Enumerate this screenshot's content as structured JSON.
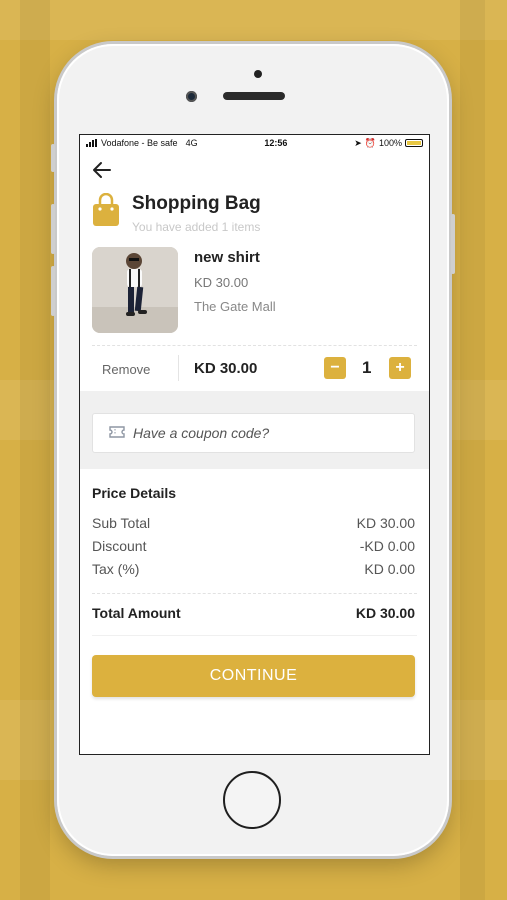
{
  "colors": {
    "accent": "#dcb13e",
    "background": "#d7b046"
  },
  "status_bar": {
    "carrier": "Vodafone - Be safe",
    "network": "4G",
    "time": "12:56",
    "battery": "100%"
  },
  "header": {
    "back_icon": "arrow-left-icon",
    "bag_icon": "shopping-bag-icon",
    "title": "Shopping Bag",
    "subtitle": "You have added 1 items"
  },
  "cart_item": {
    "name": "new shirt",
    "price": "KD 30.00",
    "store": "The Gate Mall",
    "remove_label": "Remove",
    "line_price": "KD 30.00",
    "quantity": "1",
    "minus_label": "−",
    "plus_label": "+"
  },
  "coupon": {
    "icon": "ticket-icon",
    "placeholder": "Have a coupon code?"
  },
  "price_details": {
    "title": "Price Details",
    "rows": [
      {
        "label": "Sub Total",
        "value": "KD 30.00"
      },
      {
        "label": "Discount",
        "value": "-KD 0.00"
      },
      {
        "label": "Tax (%)",
        "value": "KD 0.00"
      }
    ],
    "total_label": "Total Amount",
    "total_value": "KD 30.00"
  },
  "continue_label": "CONTINUE"
}
